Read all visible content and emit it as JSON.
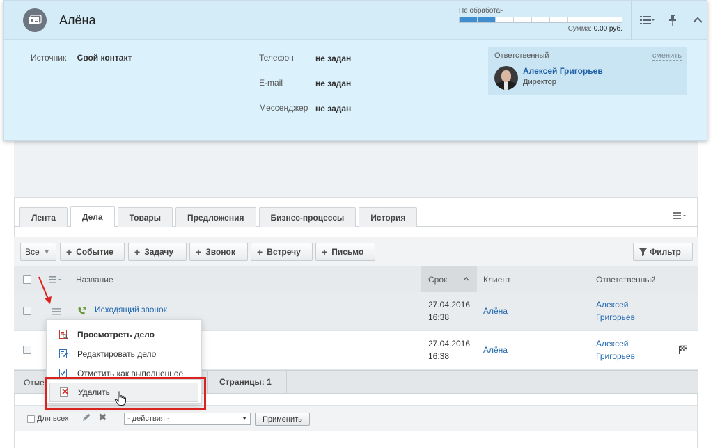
{
  "lead": {
    "name": "Алёна",
    "status_label": "Не обработан",
    "status_total": 9,
    "status_filled": 2,
    "sum_label": "Сумма:",
    "sum_value": "0.00 руб."
  },
  "info": {
    "source_key": "Источник",
    "source_val": "Свой контакт",
    "phone_key": "Телефон",
    "phone_val": "не задан",
    "email_key": "E-mail",
    "email_val": "не задан",
    "messenger_key": "Мессенджер",
    "messenger_val": "не задан"
  },
  "responsible": {
    "title": "Ответственный",
    "change": "сменить",
    "name": "Алексей Григорьев",
    "position": "Директор"
  },
  "tabs": [
    {
      "label": "Лента",
      "active": false
    },
    {
      "label": "Дела",
      "active": true
    },
    {
      "label": "Товары",
      "active": false
    },
    {
      "label": "Предложения",
      "active": false
    },
    {
      "label": "Бизнес-процессы",
      "active": false
    },
    {
      "label": "История",
      "active": false
    }
  ],
  "toolbar": {
    "all_label": "Все",
    "event": "Событие",
    "task": "Задачу",
    "call": "Звонок",
    "meeting": "Встречу",
    "letter": "Письмо",
    "filter": "Фильтр"
  },
  "grid": {
    "col_name": "Название",
    "col_deadline": "Срок",
    "col_client": "Клиент",
    "col_responsible": "Ответственный",
    "rows": [
      {
        "name": "Исходящий звонок",
        "date": "27.04.2016",
        "time": "16:38",
        "client": "Алёна",
        "resp1": "Алексей",
        "resp2": "Григорьев"
      },
      {
        "name": "",
        "date": "27.04.2016",
        "time": "16:38",
        "client": "Алёна",
        "resp1": "Алексей",
        "resp2": "Григорьев"
      }
    ]
  },
  "context_menu": {
    "view": "Просмотреть дело",
    "edit": "Редактировать дело",
    "complete": "Отметить как выполненное",
    "delete": "Удалить"
  },
  "footer": {
    "summary_prefix": "Отмеч",
    "pages": "Страницы: 1",
    "for_all": "Для всех",
    "actions_placeholder": "- действия -",
    "apply": "Применить"
  },
  "colors": {
    "card_bg": "#dbf1fc",
    "accent": "#3e8ed0",
    "link": "#2067b0",
    "highlight": "#d9231e"
  }
}
